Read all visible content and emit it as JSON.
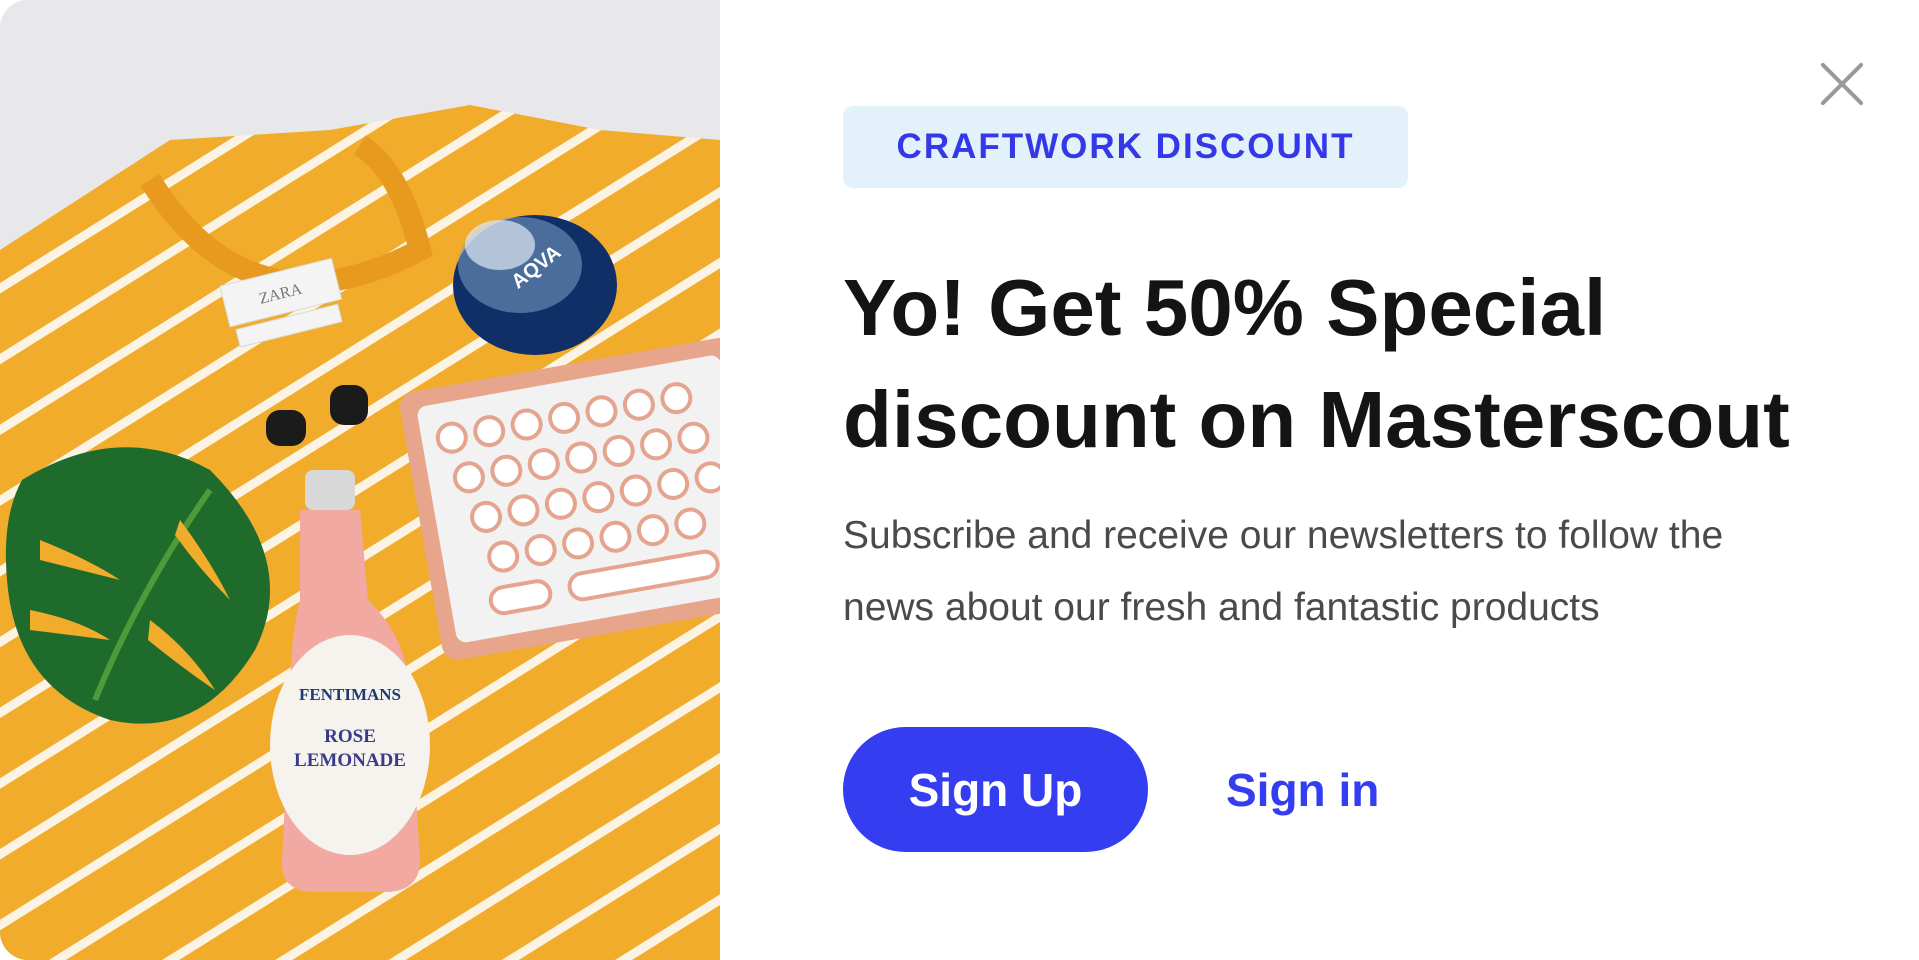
{
  "modal": {
    "badge": "CRAFTWORK DISCOUNT",
    "headline_line1": "Yo! Get 50% Special",
    "headline_line2": "discount on Masterscout",
    "subtext_line1": "Subscribe and receive our newsletters to follow the",
    "subtext_line2": "news about our fresh and fantastic products",
    "signup_label": "Sign Up",
    "signin_label": "Sign in",
    "close_icon": "close-icon"
  },
  "photo": {
    "perfume_brand": "AQVA",
    "bottle_brand": "FENTIMANS",
    "bottle_flavor_line1": "ROSE",
    "bottle_flavor_line2": "LEMONADE",
    "shirt_label": "ZARA"
  },
  "colors": {
    "accent": "#343df0",
    "badge_bg": "#e3f1fb",
    "heading": "#141414",
    "body_text": "#4a4a4a",
    "shirt": "#f1ac2b"
  }
}
